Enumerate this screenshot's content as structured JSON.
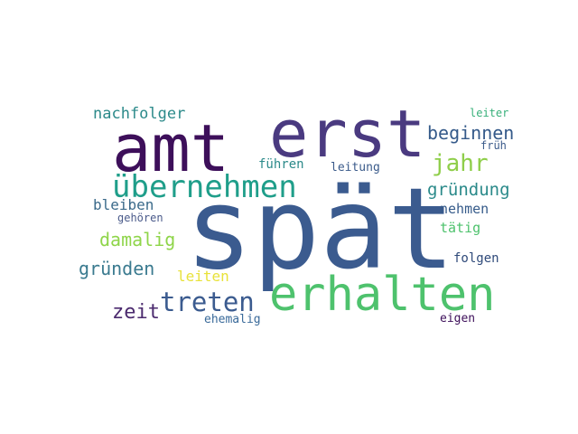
{
  "words": [
    {
      "text": "spät",
      "color": "#3b5b8f"
    },
    {
      "text": "amt",
      "color": "#3d0f5a"
    },
    {
      "text": "erst",
      "color": "#4a3a80"
    },
    {
      "text": "erhalten",
      "color": "#4ec26d"
    },
    {
      "text": "übernehmen",
      "color": "#1f9e8a"
    },
    {
      "text": "treten",
      "color": "#3b5b8f"
    },
    {
      "text": "jahr",
      "color": "#8fce4a"
    },
    {
      "text": "beginnen",
      "color": "#355a8a"
    },
    {
      "text": "gründung",
      "color": "#2b8a8a"
    },
    {
      "text": "damalig",
      "color": "#8fd54a"
    },
    {
      "text": "gründen",
      "color": "#3a7a8f"
    },
    {
      "text": "nachfolger",
      "color": "#2c8a8a"
    },
    {
      "text": "zeit",
      "color": "#4b2a6e"
    },
    {
      "text": "bleiben",
      "color": "#3b6a8a"
    },
    {
      "text": "nehmen",
      "color": "#365b8a"
    },
    {
      "text": "tätig",
      "color": "#4ec26d"
    },
    {
      "text": "leiten",
      "color": "#e8e23a"
    },
    {
      "text": "führen",
      "color": "#2c8a8a"
    },
    {
      "text": "leitung",
      "color": "#3a5a8a"
    },
    {
      "text": "folgen",
      "color": "#2f4a7a"
    },
    {
      "text": "leiter",
      "color": "#37b07a"
    },
    {
      "text": "früh",
      "color": "#3a5a8a"
    },
    {
      "text": "gehören",
      "color": "#4a5a8a"
    },
    {
      "text": "ehemalig",
      "color": "#3a6a9a"
    },
    {
      "text": "eigen",
      "color": "#3d0f5a"
    }
  ]
}
